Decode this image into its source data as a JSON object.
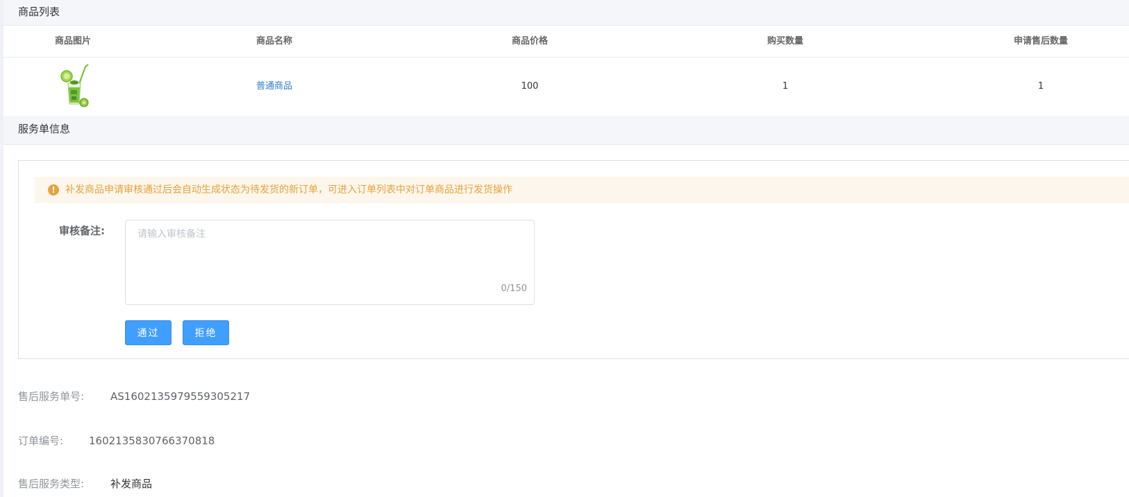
{
  "goods_section": {
    "title": "商品列表",
    "columns": [
      "商品图片",
      "商品名称",
      "商品价格",
      "购买数量",
      "申请售后数量"
    ],
    "rows": [
      {
        "image_icon": "drink-glass-image",
        "name": "普通商品",
        "price": "100",
        "quantity": "1",
        "aftersale_quantity": "1"
      }
    ]
  },
  "service_section": {
    "title": "服务单信息",
    "notice": "补发商品申请审核通过后会自动生成状态为待发货的新订单，可进入订单列表中对订单商品进行发货操作",
    "notice_icon": "exclamation-circle-icon",
    "remark_label": "审核备注:",
    "remark_placeholder": "请输入审核备注",
    "remark_value": "",
    "remark_counter": "0/150",
    "approve_label": "通过",
    "reject_label": "拒绝"
  },
  "info": [
    {
      "label": "售后服务单号:",
      "value": "AS1602135979559305217"
    },
    {
      "label": "订单编号:",
      "value": "1602135830766370818"
    },
    {
      "label": "售后服务类型:",
      "value": "补发商品"
    }
  ],
  "colors": {
    "primary": "#409eff",
    "warning": "#e6a23c",
    "warning_bg": "#fdf6ec",
    "link": "#2d7bd2",
    "header_bg": "#f4f6fa"
  }
}
